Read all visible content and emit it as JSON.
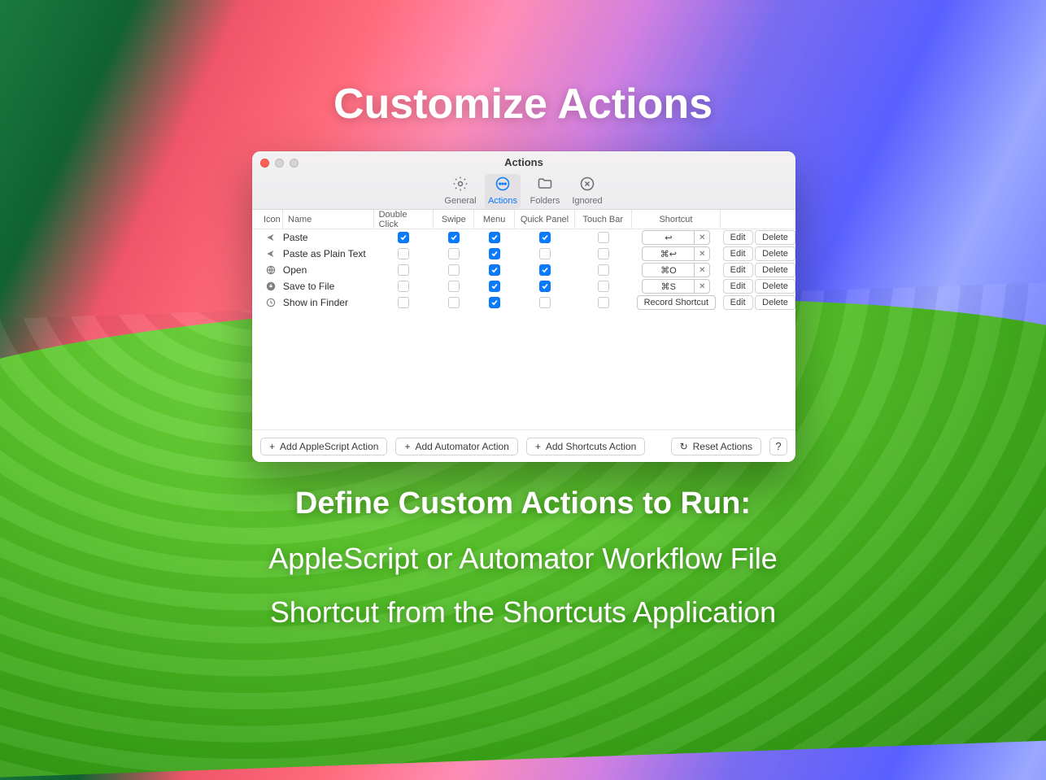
{
  "hero_title": "Customize Actions",
  "footer_line_1": "Define Custom Actions to Run:",
  "footer_line_2": "AppleScript or Automator Workflow File",
  "footer_line_3": "Shortcut from the Shortcuts Application",
  "window": {
    "title": "Actions",
    "tabs": {
      "general": "General",
      "actions": "Actions",
      "folders": "Folders",
      "ignored": "Ignored"
    },
    "columns": {
      "icon": "Icon",
      "name": "Name",
      "double_click": "Double Click",
      "swipe": "Swipe",
      "menu": "Menu",
      "quick_panel": "Quick Panel",
      "touch_bar": "Touch Bar",
      "shortcut": "Shortcut"
    },
    "rows": [
      {
        "icon": "share",
        "name": "Paste",
        "double_click": true,
        "swipe": true,
        "menu": true,
        "quick_panel": true,
        "touch_bar": false,
        "shortcut": "↩",
        "has_shortcut": true
      },
      {
        "icon": "share",
        "name": "Paste as Plain Text",
        "double_click": false,
        "swipe": false,
        "menu": true,
        "quick_panel": false,
        "touch_bar": false,
        "shortcut": "⌘↩",
        "has_shortcut": true
      },
      {
        "icon": "globe",
        "name": "Open",
        "double_click": false,
        "swipe": false,
        "menu": true,
        "quick_panel": true,
        "touch_bar": false,
        "shortcut": "⌘O",
        "has_shortcut": true
      },
      {
        "icon": "download",
        "name": "Save to File",
        "double_click": false,
        "swipe": false,
        "menu": true,
        "quick_panel": true,
        "touch_bar": false,
        "shortcut": "⌘S",
        "has_shortcut": true
      },
      {
        "icon": "clock",
        "name": "Show in Finder",
        "double_click": false,
        "swipe": false,
        "menu": true,
        "quick_panel": false,
        "touch_bar": false,
        "shortcut": "",
        "has_shortcut": false
      }
    ],
    "record_shortcut_label": "Record Shortcut",
    "edit_label": "Edit",
    "delete_label": "Delete",
    "add_applescript": "Add AppleScript Action",
    "add_automator": "Add Automator Action",
    "add_shortcuts": "Add Shortcuts Action",
    "reset_actions": "Reset Actions",
    "help": "?"
  }
}
